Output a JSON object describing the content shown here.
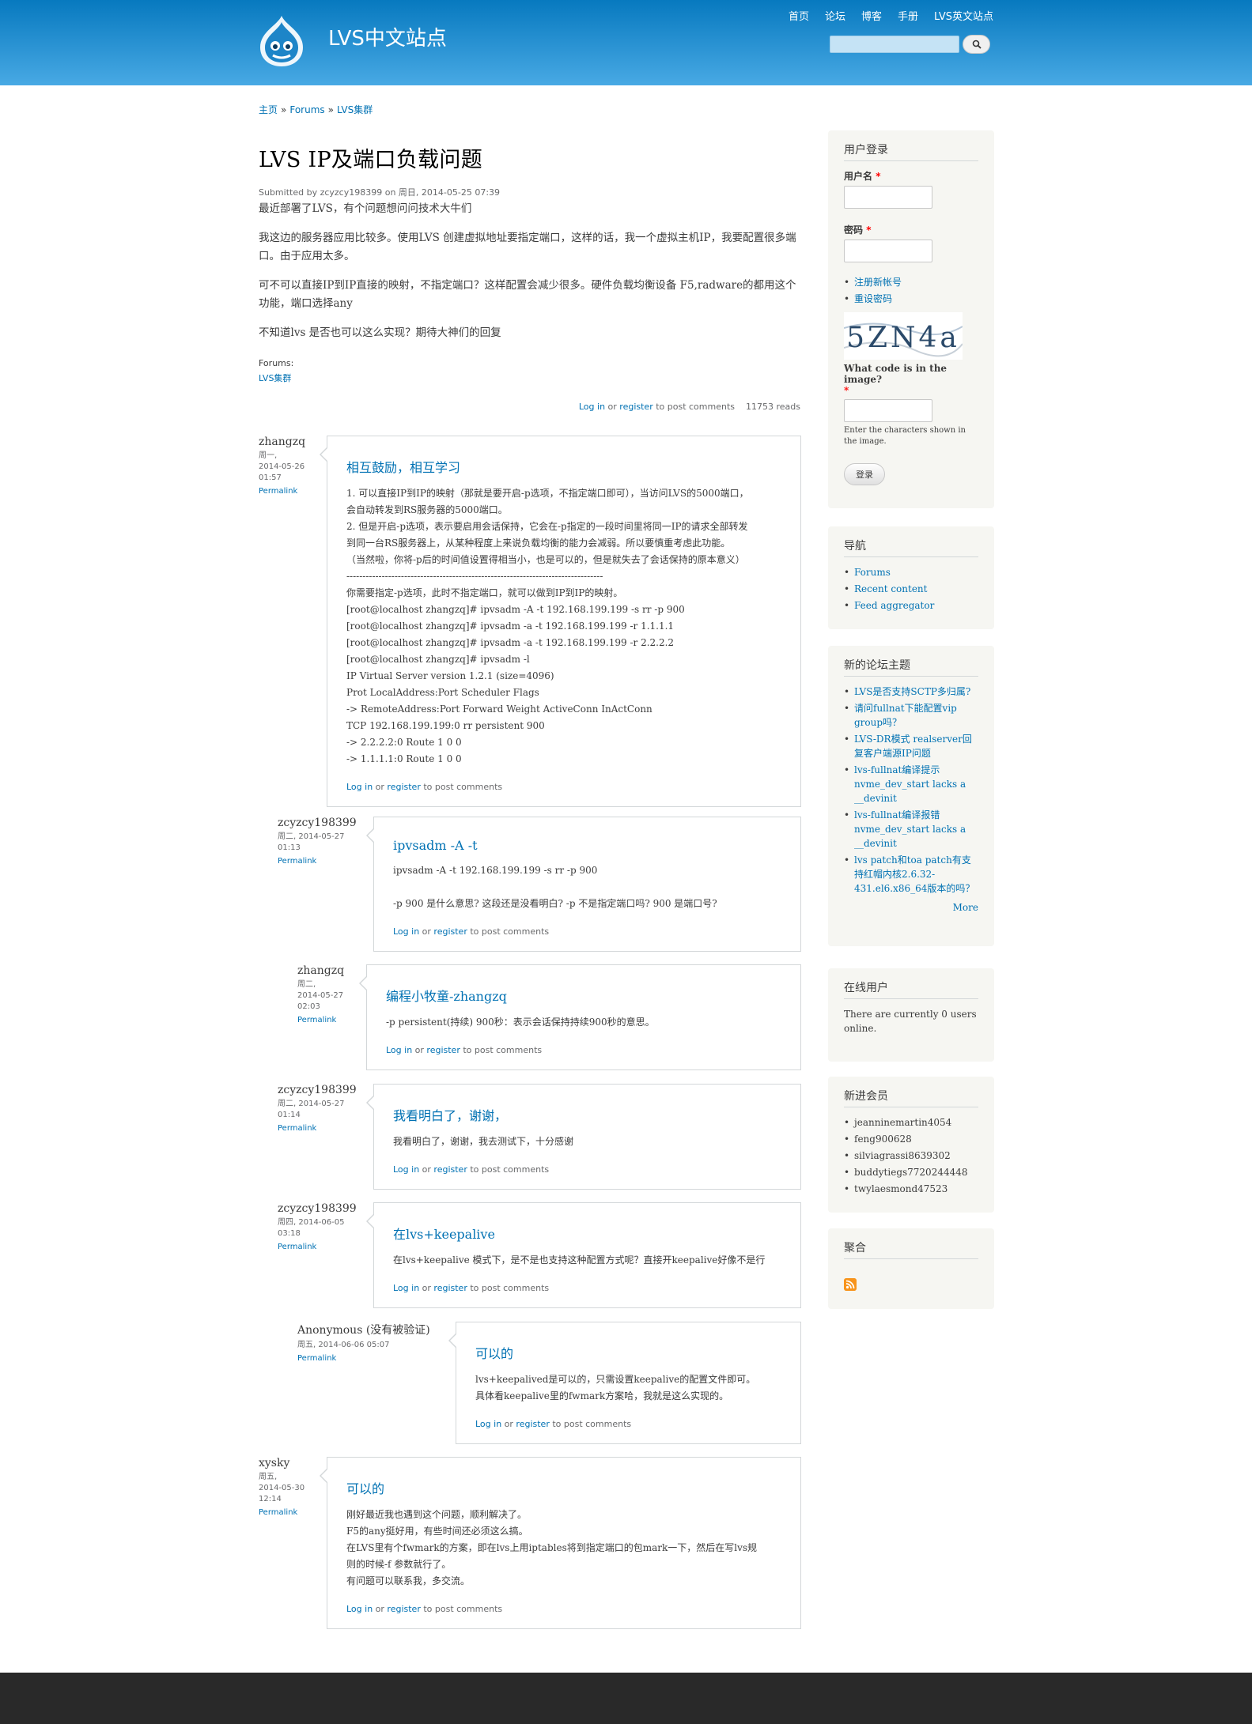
{
  "header": {
    "site_name": "LVS中文站点",
    "menu": [
      "首页",
      "论坛",
      "博客",
      "手册",
      "LVS英文站点"
    ],
    "search_placeholder": ""
  },
  "breadcrumb": [
    "主页",
    "Forums",
    "LVS集群"
  ],
  "article": {
    "title": "LVS IP及端口负载问题",
    "submitted_prefix": "Submitted by ",
    "submitted_user": "zcyzcy198399",
    "submitted_suffix": " on 周日, 2014-05-25 07:39",
    "paragraphs": [
      "最近部署了LVS，有个问题想问问技术大牛们",
      "我这边的服务器应用比较多。使用LVS 创建虚拟地址要指定端口，这样的话，我一个虚拟主机IP，我要配置很多端口。由于应用太多。",
      "可不可以直接IP到IP直接的映射，不指定端口？这样配置会减少很多。硬件负载均衡设备 F5,radware的都用这个功能，端口选择any",
      "不知道lvs 是否也可以这么实现？期待大神们的回复"
    ],
    "forums_label": "Forums:",
    "forums_link": "LVS集群",
    "login": "Log in",
    "or": " or ",
    "register": "register",
    "to_post": " to post comments",
    "reads": "11753 reads"
  },
  "comments": [
    {
      "author": "zhangzq",
      "date_lines": [
        "周一,",
        "2014-05-26",
        "01:57"
      ],
      "permalink": "Permalink",
      "title": "相互鼓励，相互学习",
      "lines": [
        "1. 可以直接IP到IP的映射（那就是要开启-p选项，不指定端口即可），当访问LVS的5000端口，",
        "会自动转发到RS服务器的5000端口。",
        "2. 但是开启-p选项，表示要启用会话保持，它会在-p指定的一段时间里将同一IP的请求全部转发",
        "到同一台RS服务器上，从某种程度上来说负载均衡的能力会减弱。所以要慎重考虑此功能。",
        "（当然啦，你将-p后的时间值设置得相当小，也是可以的，但是就失去了会话保持的原本意义）",
        "--------------------------------------------------------------------------------",
        "你需要指定-p选项，此时不指定端口，就可以做到IP到IP的映射。",
        "[root@localhost zhangzq]# ipvsadm -A -t 192.168.199.199 -s rr -p 900",
        "[root@localhost zhangzq]# ipvsadm -a -t 192.168.199.199 -r 1.1.1.1",
        "[root@localhost zhangzq]# ipvsadm -a -t 192.168.199.199 -r 2.2.2.2",
        "[root@localhost zhangzq]# ipvsadm -l",
        "IP Virtual Server version 1.2.1 (size=4096)",
        "Prot LocalAddress:Port Scheduler Flags",
        "-> RemoteAddress:Port Forward Weight ActiveConn InActConn",
        "TCP 192.168.199.199:0 rr persistent 900",
        "-> 2.2.2.2:0 Route 1 0 0",
        "-> 1.1.1.1:0 Route 1 0 0"
      ],
      "login": "Log in",
      "or": " or ",
      "register": "register",
      "to_post": " to post comments"
    },
    {
      "author": "zcyzcy198399",
      "date_lines": [
        "周二, 2014-05-27",
        "01:13"
      ],
      "permalink": "Permalink",
      "title": "ipvsadm -A -t",
      "lines": [
        "ipvsadm -A -t 192.168.199.199 -s rr -p 900",
        "",
        "-p 900 是什么意思? 这段还是没看明白? -p 不是指定端口吗? 900 是端口号?"
      ],
      "login": "Log in",
      "or": " or ",
      "register": "register",
      "to_post": " to post comments"
    },
    {
      "author": "zhangzq",
      "date_lines": [
        "周二,",
        "2014-05-27",
        "02:03"
      ],
      "permalink": "Permalink",
      "title": "编程小牧童-zhangzq",
      "lines": [
        "-p persistent(持续) 900秒：表示会话保持持续900秒的意思。"
      ],
      "login": "Log in",
      "or": " or ",
      "register": "register",
      "to_post": " to post comments"
    },
    {
      "author": "zcyzcy198399",
      "date_lines": [
        "周二, 2014-05-27",
        "01:14"
      ],
      "permalink": "Permalink",
      "title": "我看明白了，谢谢，",
      "lines": [
        "我看明白了，谢谢，我去测试下，十分感谢"
      ],
      "login": "Log in",
      "or": " or ",
      "register": "register",
      "to_post": " to post comments"
    },
    {
      "author": "zcyzcy198399",
      "date_lines": [
        "周四, 2014-06-05",
        "03:18"
      ],
      "permalink": "Permalink",
      "title": "在lvs+keepalive",
      "lines": [
        "在lvs+keepalive 模式下，是不是也支持这种配置方式呢？直接开keepalive好像不是行"
      ],
      "login": "Log in",
      "or": " or ",
      "register": "register",
      "to_post": " to post comments"
    },
    {
      "author": "Anonymous (没有被验证)",
      "date_lines": [
        "周五, 2014-06-06 05:07"
      ],
      "permalink": "Permalink",
      "title": "可以的",
      "lines": [
        "lvs+keepalived是可以的，只需设置keepalive的配置文件即可。",
        "具体看keepalive里的fwmark方案哈，我就是这么实现的。"
      ],
      "login": "Log in",
      "or": " or ",
      "register": "register",
      "to_post": " to post comments"
    },
    {
      "author": "xysky",
      "date_lines": [
        "周五,",
        "2014-05-30",
        "12:14"
      ],
      "permalink": "Permalink",
      "title": "可以的",
      "lines": [
        "刚好最近我也遇到这个问题，顺利解决了。",
        "F5的any挺好用，有些时间还必须这么搞。",
        "在LVS里有个fwmark的方案，即在lvs上用iptables将到指定端口的包mark一下，然后在写lvs规",
        "则的时候-f 参数就行了。",
        "有问题可以联系我，多交流。"
      ],
      "login": "Log in",
      "or": " or ",
      "register": "register",
      "to_post": " to post comments"
    }
  ],
  "sidebar": {
    "login": {
      "title": "用户登录",
      "username_label": "用户名",
      "password_label": "密码",
      "required_mark": "*",
      "links": [
        "注册新帐号",
        "重设密码"
      ],
      "captcha_text": "5ZN4a",
      "captcha_question": "What code is in the image?",
      "captcha_desc": "Enter the characters shown in the image.",
      "submit": "登录"
    },
    "nav": {
      "title": "导航",
      "items": [
        "Forums",
        "Recent content",
        "Feed aggregator"
      ]
    },
    "forum_topics": {
      "title": "新的论坛主题",
      "items": [
        "LVS是否支持SCTP多归属?",
        "请问fullnat下能配置vip group吗？",
        "LVS-DR模式 realserver回复客户端源IP问题",
        "lvs-fullnat编译提示 nvme_dev_start lacks a __devinit",
        "lvs-fullnat编译报错 nvme_dev_start lacks a __devinit",
        "lvs patch和toa patch有支持红帽内核2.6.32-431.el6.x86_64版本的吗？"
      ],
      "more": "More"
    },
    "online": {
      "title": "在线用户",
      "text": "There are currently 0 users online."
    },
    "new_members": {
      "title": "新进会员",
      "items": [
        "jeanninemartin4054",
        "feng900628",
        "silviagrassi8639302",
        "buddytiegs7720244448",
        "twylaesmond47523"
      ]
    },
    "feed": {
      "title": "聚合"
    }
  }
}
